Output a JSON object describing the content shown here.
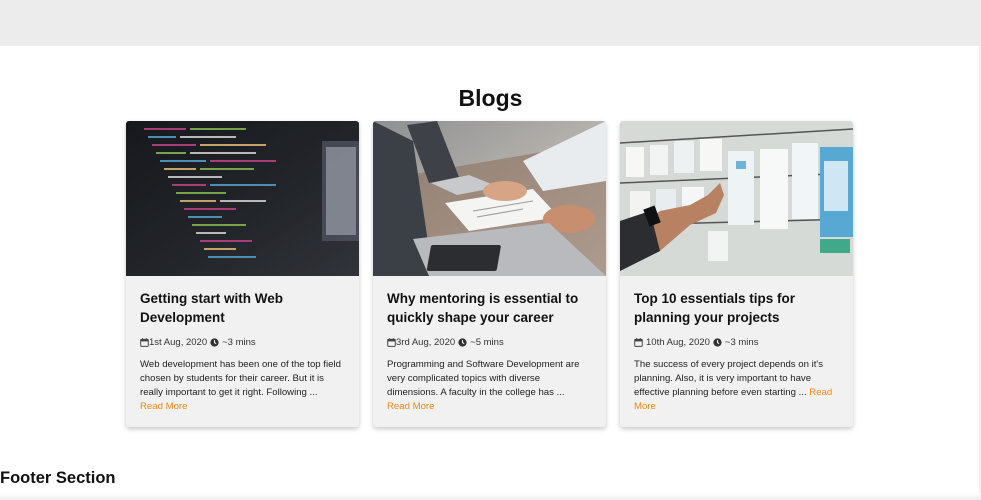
{
  "page": {
    "heading": "Blogs",
    "footer_heading": "Footer Section"
  },
  "colors": {
    "accent": "#e98a12",
    "card_bg": "#f1f1f1",
    "topbar_bg": "#ececec"
  },
  "blogs": [
    {
      "title": "Getting start with Web Development",
      "date": "1st Aug, 2020",
      "read_time": "~3 mins",
      "excerpt": "Web development has been one of the top field chosen by students for their career. But it is really important to get it right. Following ...",
      "read_more": "Read More",
      "image_icon": "code-screen-photo"
    },
    {
      "title": "Why mentoring is essential to quickly shape your career",
      "date": "3rd Aug, 2020",
      "read_time": "~5 mins",
      "excerpt": "Programming and Software Development are very complicated topics with diverse dimensions. A faculty in the college has ...",
      "read_more": "Read More",
      "image_icon": "laptop-desk-photo"
    },
    {
      "title": "Top 10 essentials tips for planning your projects",
      "date": "10th Aug, 2020",
      "read_time": "~3 mins",
      "excerpt": "The success of every project depends on it's planning. Also, it is very important to have effective planning before even starting ...",
      "read_more": "Read More",
      "image_icon": "planning-board-photo"
    }
  ]
}
